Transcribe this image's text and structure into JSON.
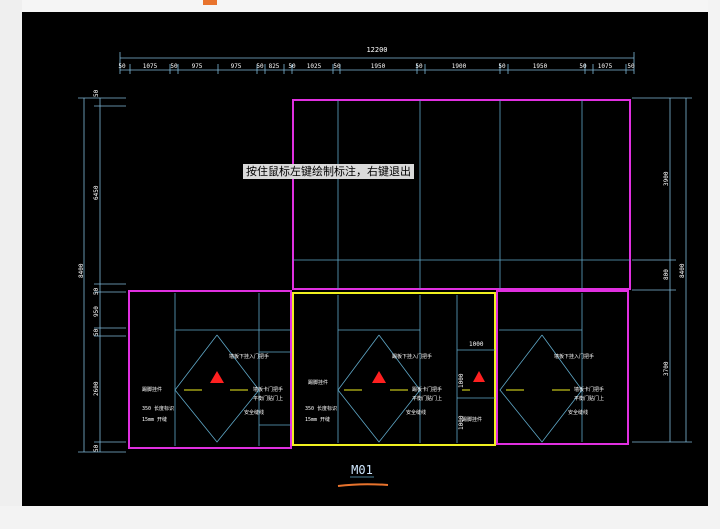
{
  "app": {
    "tooltip_text": "按住鼠标左键绘制标注，右键退出"
  },
  "drawing": {
    "overall_width": "12200",
    "top_dims": [
      "50",
      "1075",
      "50",
      "975",
      "975",
      "50",
      "825",
      "50",
      "1025",
      "50",
      "1950",
      "50",
      "1900",
      "50",
      "1950",
      "50",
      "1075",
      "50"
    ],
    "left_dims_inner": [
      "50",
      "6450",
      "50",
      "950",
      "50",
      "2600",
      "50"
    ],
    "left_dim_total": "8400",
    "right_dims_inner": [
      "3900",
      "800",
      "3700"
    ],
    "right_dim_total": "8400",
    "cabinet_label": "M01",
    "label_1000_a": "1000",
    "label_1000_b": "1000",
    "label_1000_c": "1000",
    "annotations": {
      "left_top": "墙板下挂入门把手",
      "left_mid": "墙板卡门把手",
      "left_mid2": "平衡门贴门上",
      "left_safe": "安全缝线",
      "left_350": "350 长度标识",
      "left_15": "15mm 开缝",
      "center_top": "踢板下挂入门把手",
      "center_mid": "踢板卡门把手",
      "center_mid2": "平衡门贴门上",
      "center_safe": "安全缝线",
      "center_350": "350 长度标识",
      "center_15": "15mm 开缝",
      "right_top": "墙板下挂入门把手",
      "right_mid": "墙板卡门把手",
      "right_mid2": "平衡门贴门上",
      "right_safe": "安全缝线",
      "left_hang": "踢脚挂件",
      "center_hang": "踢脚挂件",
      "right_hang": "踢脚挂件"
    }
  },
  "colors": {
    "magenta": "#e030e0",
    "yellow": "#f0f020",
    "cyan_line": "#5fa8c8",
    "dim_line": "#7fb8d8",
    "red_marker": "#ff2020",
    "orange_underline": "#e8732d"
  }
}
